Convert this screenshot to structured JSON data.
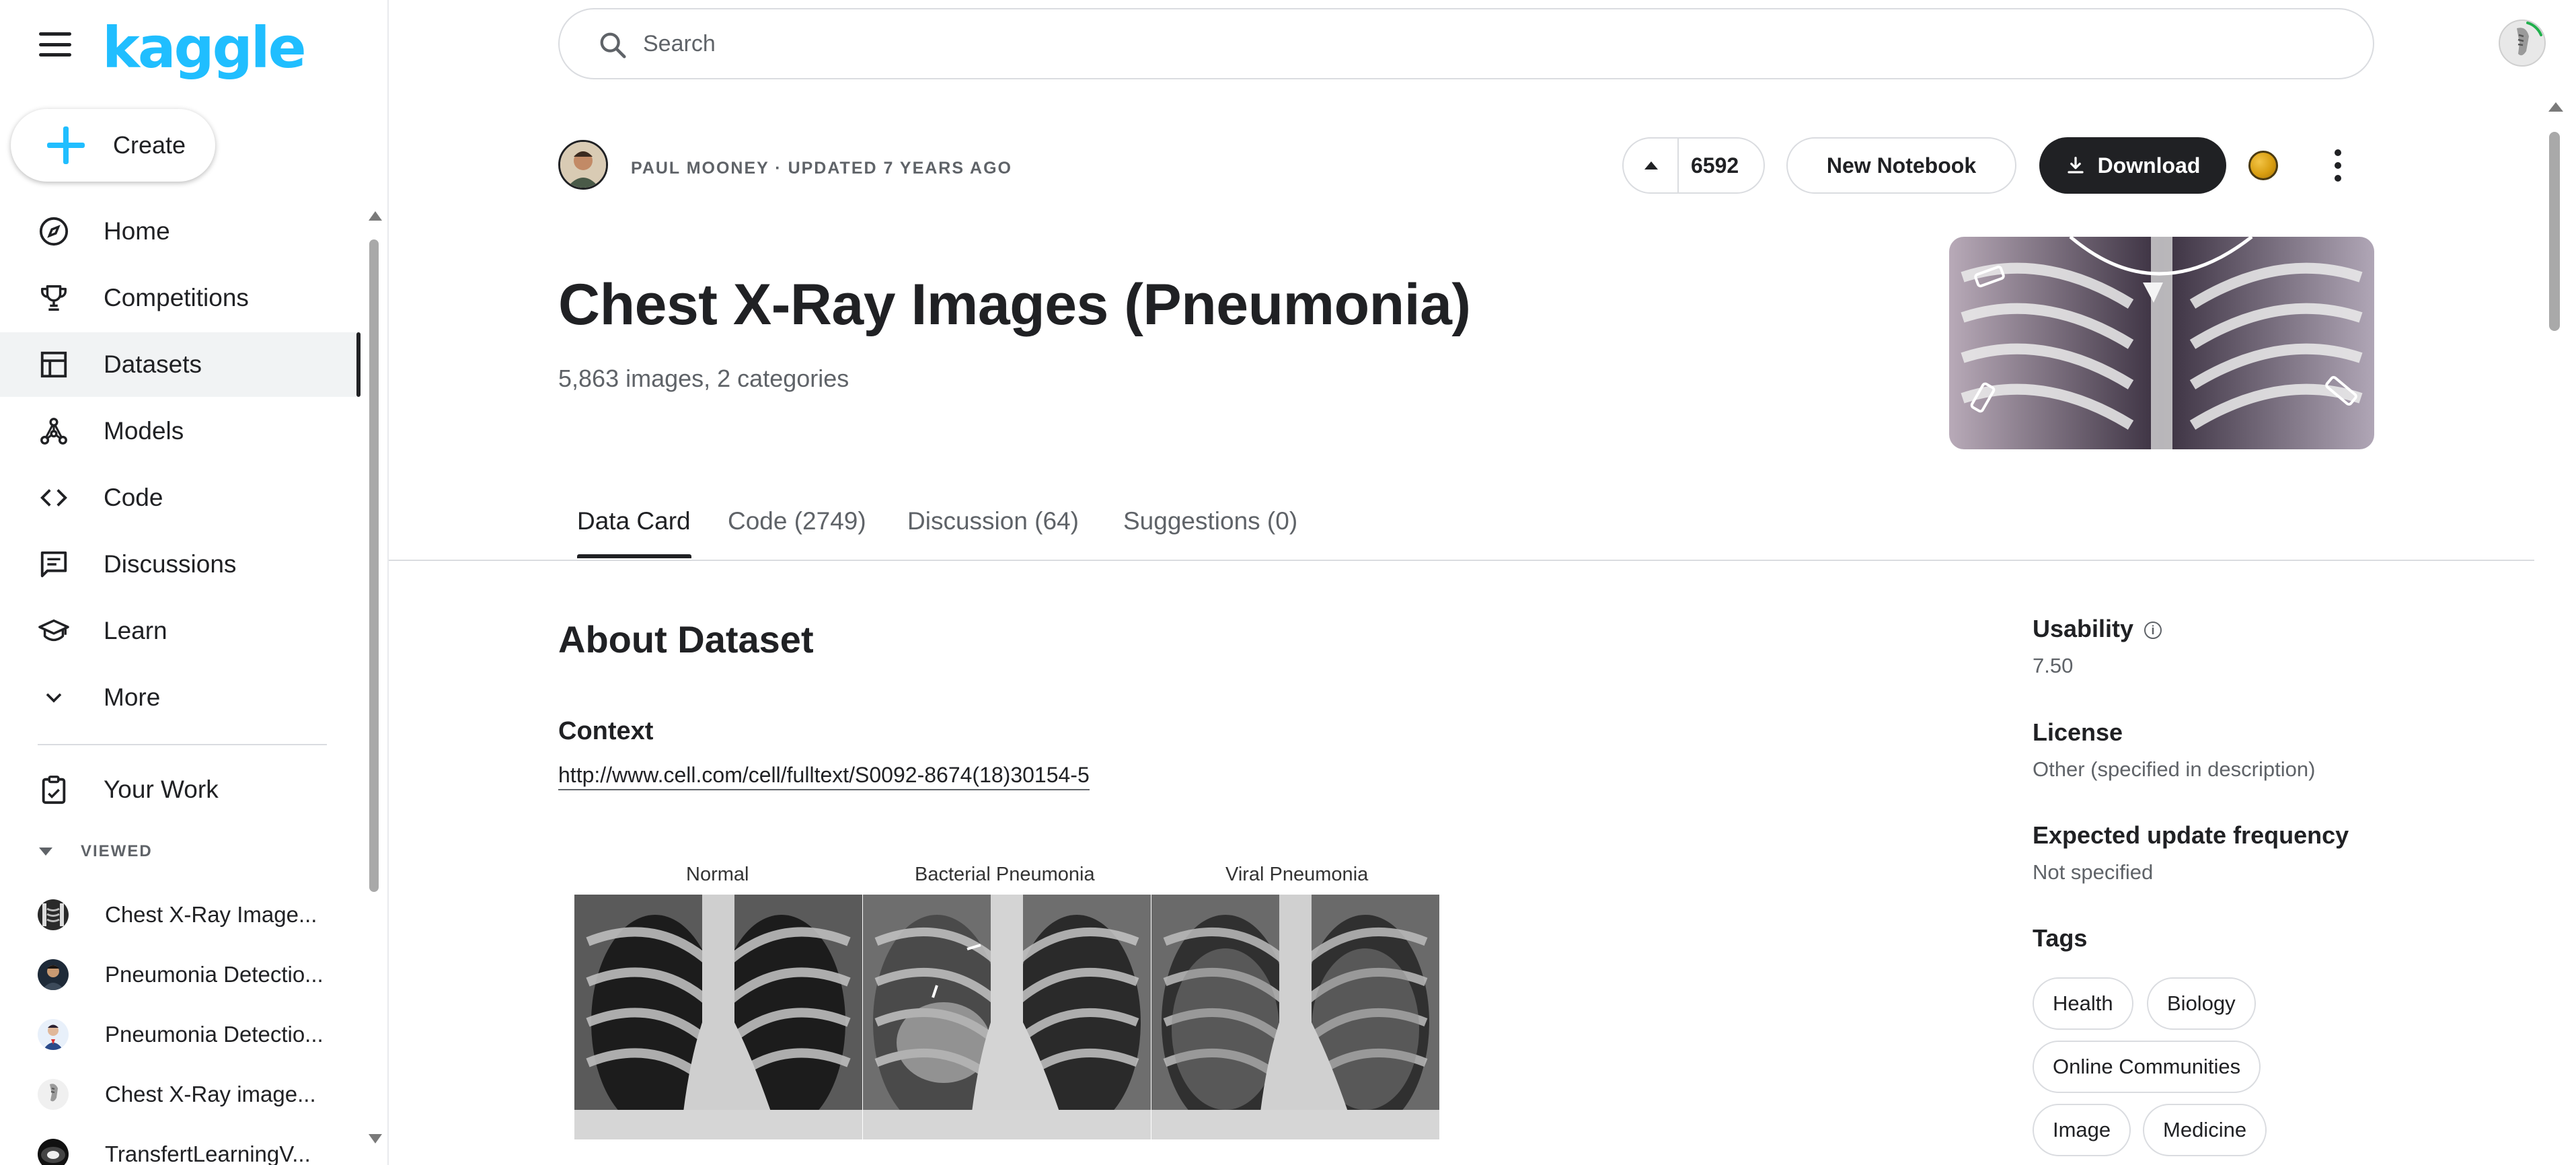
{
  "sidebar": {
    "logo": "kaggle",
    "create_label": "Create",
    "nav": [
      {
        "label": "Home",
        "icon": "compass-icon"
      },
      {
        "label": "Competitions",
        "icon": "trophy-icon"
      },
      {
        "label": "Datasets",
        "icon": "table-icon",
        "active": true
      },
      {
        "label": "Models",
        "icon": "models-icon"
      },
      {
        "label": "Code",
        "icon": "code-icon"
      },
      {
        "label": "Discussions",
        "icon": "discussions-icon"
      },
      {
        "label": "Learn",
        "icon": "graduation-cap-icon"
      },
      {
        "label": "More",
        "icon": "chevron-down-icon"
      }
    ],
    "your_work": "Your Work",
    "viewed_header": "VIEWED",
    "recent": [
      "Chest X-Ray Image...",
      "Pneumonia Detectio...",
      "Pneumonia Detectio...",
      "Chest X-Ray image...",
      "TransfertLearningV..."
    ]
  },
  "search": {
    "placeholder": "Search"
  },
  "dataset": {
    "author_line": "PAUL MOONEY · UPDATED 7 YEARS AGO",
    "upvotes": "6592",
    "new_notebook_label": "New Notebook",
    "download_label": "Download",
    "title": "Chest X-Ray Images (Pneumonia)",
    "subtitle": "5,863 images, 2 categories"
  },
  "tabs": [
    "Data Card",
    "Code (2749)",
    "Discussion (64)",
    "Suggestions (0)"
  ],
  "content": {
    "about_heading": "About Dataset",
    "context_heading": "Context",
    "context_link": "http://www.cell.com/cell/fulltext/S0092-8674(18)30154-5",
    "figure_captions": [
      "Normal",
      "Bacterial Pneumonia",
      "Viral Pneumonia"
    ]
  },
  "meta": {
    "usability_label": "Usability",
    "usability_value": "7.50",
    "license_label": "License",
    "license_value": "Other (specified in description)",
    "frequency_label": "Expected update frequency",
    "frequency_value": "Not specified",
    "tags_label": "Tags",
    "tags": [
      "Health",
      "Biology",
      "Online Communities",
      "Image",
      "Medicine"
    ]
  },
  "colors": {
    "brand": "#20beff",
    "dark_button": "#202124",
    "active_nav_bg": "#f1f3f4"
  }
}
